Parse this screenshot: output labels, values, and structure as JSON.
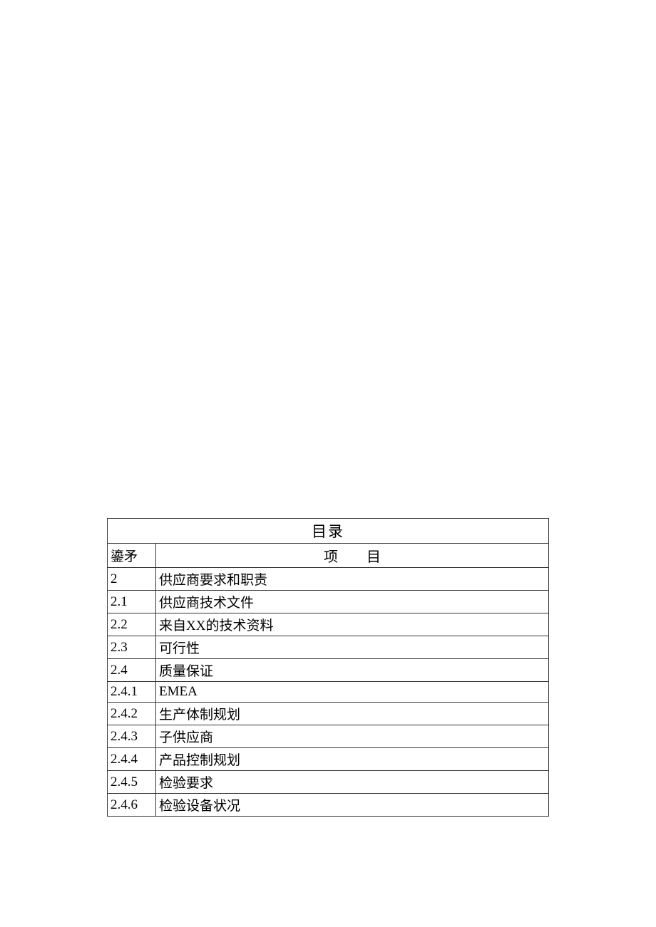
{
  "table": {
    "title": "目录",
    "headers": {
      "col1": "鎏矛",
      "col2": "项　　目"
    },
    "rows": [
      {
        "num": "2",
        "item": "供应商要求和职责"
      },
      {
        "num": "2.1",
        "item": "供应商技术文件"
      },
      {
        "num": "2.2",
        "item": "来自XX的技术资料"
      },
      {
        "num": "2.3",
        "item": "可行性"
      },
      {
        "num": "2.4",
        "item": "质量保证"
      },
      {
        "num": "2.4.1",
        "item": "EMEA"
      },
      {
        "num": "2.4.2",
        "item": "生产体制规划"
      },
      {
        "num": "2.4.3",
        "item": "子供应商"
      },
      {
        "num": "2.4.4",
        "item": "产品控制规划"
      },
      {
        "num": "2.4.5",
        "item": "检验要求"
      },
      {
        "num": "2.4.6",
        "item": "检验设备状况"
      }
    ]
  }
}
